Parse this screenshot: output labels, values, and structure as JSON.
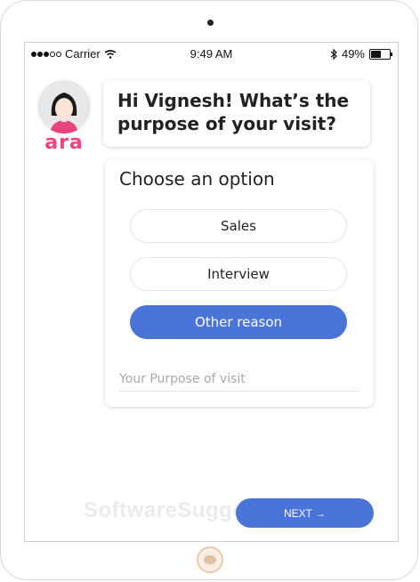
{
  "status_bar": {
    "carrier": "Carrier",
    "time": "9:49 AM",
    "battery": "49%",
    "battery_level": 0.49
  },
  "brand": {
    "name": "ara"
  },
  "chat": {
    "greeting": "Hi Vignesh! What’s the purpose of your visit?"
  },
  "options_card": {
    "title": "Choose an option",
    "options": [
      {
        "label": "Sales",
        "selected": false
      },
      {
        "label": "Interview",
        "selected": false
      },
      {
        "label": "Other reason",
        "selected": true
      }
    ],
    "purpose_placeholder": "Your Purpose of visit"
  },
  "footer": {
    "next_label": "NEXT",
    "next_arrow": "→",
    "watermark": "SoftwareSugge"
  },
  "colors": {
    "accent": "#4b74d8",
    "brand": "#f0457a"
  }
}
